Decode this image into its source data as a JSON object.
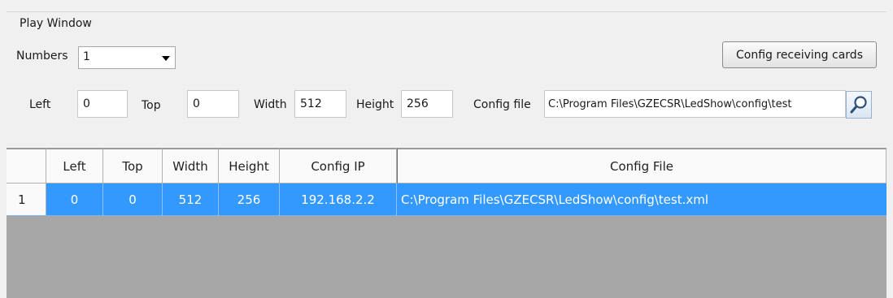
{
  "group": {
    "title": "Play Window"
  },
  "numbers": {
    "label": "Numbers",
    "value": "1"
  },
  "config_button": {
    "label": "Config receiving cards"
  },
  "fields": {
    "left": {
      "label": "Left",
      "value": "0"
    },
    "top": {
      "label": "Top",
      "value": "0"
    },
    "width": {
      "label": "Width",
      "value": "512"
    },
    "height": {
      "label": "Height",
      "value": "256"
    },
    "config_file": {
      "label": "Config file",
      "value": "C:\\Program Files\\GZECSR\\LedShow\\config\\test"
    }
  },
  "browse_icon": "magnifier-icon",
  "table": {
    "columns": [
      "",
      "Left",
      "Top",
      "Width",
      "Height",
      "Config IP",
      "Config File"
    ],
    "rows": [
      [
        "1",
        "0",
        "0",
        "512",
        "256",
        "192.168.2.2",
        "C:\\Program Files\\GZECSR\\LedShow\\config\\test.xml"
      ]
    ],
    "selection_color": "#3399ff",
    "empty_area_color": "#a7a7a7"
  }
}
